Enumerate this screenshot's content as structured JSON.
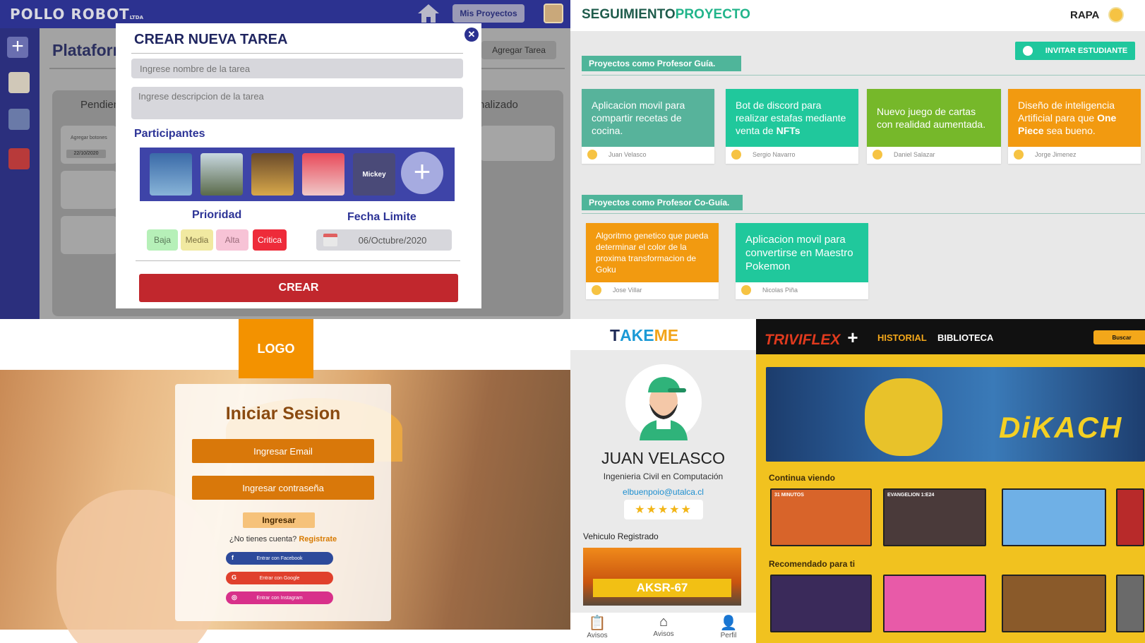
{
  "pollo": {
    "brand": "POLLO ROBOT",
    "brand_sub": "LTDA",
    "mis_proyectos": "Mis Proyectos",
    "plataforma": "Plataform",
    "agregar_tarea": "Agregar Tarea",
    "col_pendiente": "Pendien",
    "col_finalizado": "nalizado",
    "task_text": "Agregar botones",
    "task_date": "22/10/2020",
    "modal": {
      "title": "CREAR NUEVA TAREA",
      "close": "✕",
      "name_placeholder": "Ingrese nombre de la tarea",
      "desc_placeholder": "Ingrese descripcion de la tarea",
      "participantes": "Participantes",
      "mickey_label": "Mickey",
      "add_symbol": "+",
      "prioridad": "Prioridad",
      "fecha_limite": "Fecha Limite",
      "priorities": [
        {
          "label": "Baja",
          "bg": "#b6f0b8",
          "fg": "#5a7a5a"
        },
        {
          "label": "Media",
          "bg": "#f1e9a1",
          "fg": "#7a7040"
        },
        {
          "label": "Alta",
          "bg": "#f7c3d6",
          "fg": "#9a6a7a"
        },
        {
          "label": "Critica",
          "bg": "#ee2b3a",
          "fg": "#ffffff"
        }
      ],
      "date_value": "06/Octubre/2020",
      "crear": "CREAR"
    }
  },
  "seguimiento": {
    "logo_a": "SEGUIMIENTO",
    "logo_b": "PROYECTO",
    "user": "RAPA",
    "invitar": "INVITAR ESTUDIANTE",
    "section_guia": "Proyectos como Profesor Guía.",
    "section_coguia": "Proyectos como Profesor Co-Guía.",
    "guia_cards": [
      {
        "pre": "Aplicacion movil para compartir recetas de cocina.",
        "bold": "",
        "post": "",
        "owner": "Juan Velasco",
        "color": "#57b39b"
      },
      {
        "pre": "Bot de discord para realizar estafas mediante venta de ",
        "bold": "NFTs",
        "post": "",
        "owner": "Sergio Navarro",
        "color": "#20c89c"
      },
      {
        "pre": "Nuevo juego de cartas con realidad aumentada.",
        "bold": "",
        "post": "",
        "owner": "Daniel Salazar",
        "color": "#76b82a"
      },
      {
        "pre": "Diseño de inteligencia Artificial para que ",
        "bold": "One Piece",
        "post": " sea bueno.",
        "owner": "Jorge Jimenez",
        "color": "#f29a10"
      }
    ],
    "coguia_cards": [
      {
        "pre": "Algoritmo genetico que pueda determinar el color de la proxima transformacion de Goku",
        "bold": "",
        "post": "",
        "owner": "Jose Villar",
        "color": "#f29a10"
      },
      {
        "pre": "Aplicacion movil para convertirse en Maestro Pokemon",
        "bold": "",
        "post": "",
        "owner": "Nicolas Piña",
        "color": "#20c89c"
      }
    ]
  },
  "login": {
    "logo": "LOGO",
    "title": "Iniciar Sesion",
    "email": "Ingresar Email",
    "password": "Ingresar contraseña",
    "ingresar": "Ingresar",
    "no_account": "¿No tienes cuenta?",
    "registrate": "Registrate",
    "social": [
      {
        "label": "Entrar con Facebook",
        "icon": "f",
        "color": "#2d4a9b"
      },
      {
        "label": "Entrar con Google",
        "icon": "G",
        "color": "#e0402c"
      },
      {
        "label": "Entrar con Instagram",
        "icon": "◎",
        "color": "#d8308a"
      }
    ]
  },
  "takeme": {
    "logo_a": "T",
    "logo_b": "AKE",
    "logo_c": "ME",
    "name": "JUAN VELASCO",
    "career": "Ingenieria Civil en Computación",
    "email": "elbuenpoio@utalca.cl",
    "stars": "★★★★★",
    "vehiculo": "Vehiculo Registrado",
    "plate": "AKSR-67",
    "nav": [
      {
        "icon": "📋",
        "label": "Avisos"
      },
      {
        "icon": "⌂",
        "label": "Avisos"
      },
      {
        "icon": "👤",
        "label": "Perfil"
      }
    ]
  },
  "triviflex": {
    "logo": "TRIVIFLEX",
    "logo_plus": "+",
    "historial": "HISTORIAL",
    "biblioteca": "BIBLIOTECA",
    "buscar": "Buscar",
    "hero_text": "DiKACH",
    "continua": "Continua viendo",
    "recomendado": "Recomendado para ti",
    "continua_thumbs": [
      {
        "label": "31 MINUTOS",
        "color": "#d8642a"
      },
      {
        "label": "EVANGELION 1:E24",
        "color": "#4a3a3a"
      },
      {
        "label": "",
        "color": "#6fb0e6"
      },
      {
        "label": "",
        "color": "#b82a2a"
      }
    ],
    "recomendado_thumbs": [
      {
        "label": "",
        "color": "#3a2a5a"
      },
      {
        "label": "",
        "color": "#e85aa8"
      },
      {
        "label": "",
        "color": "#8a5a2a"
      },
      {
        "label": "",
        "color": "#6a6a6a"
      }
    ]
  }
}
